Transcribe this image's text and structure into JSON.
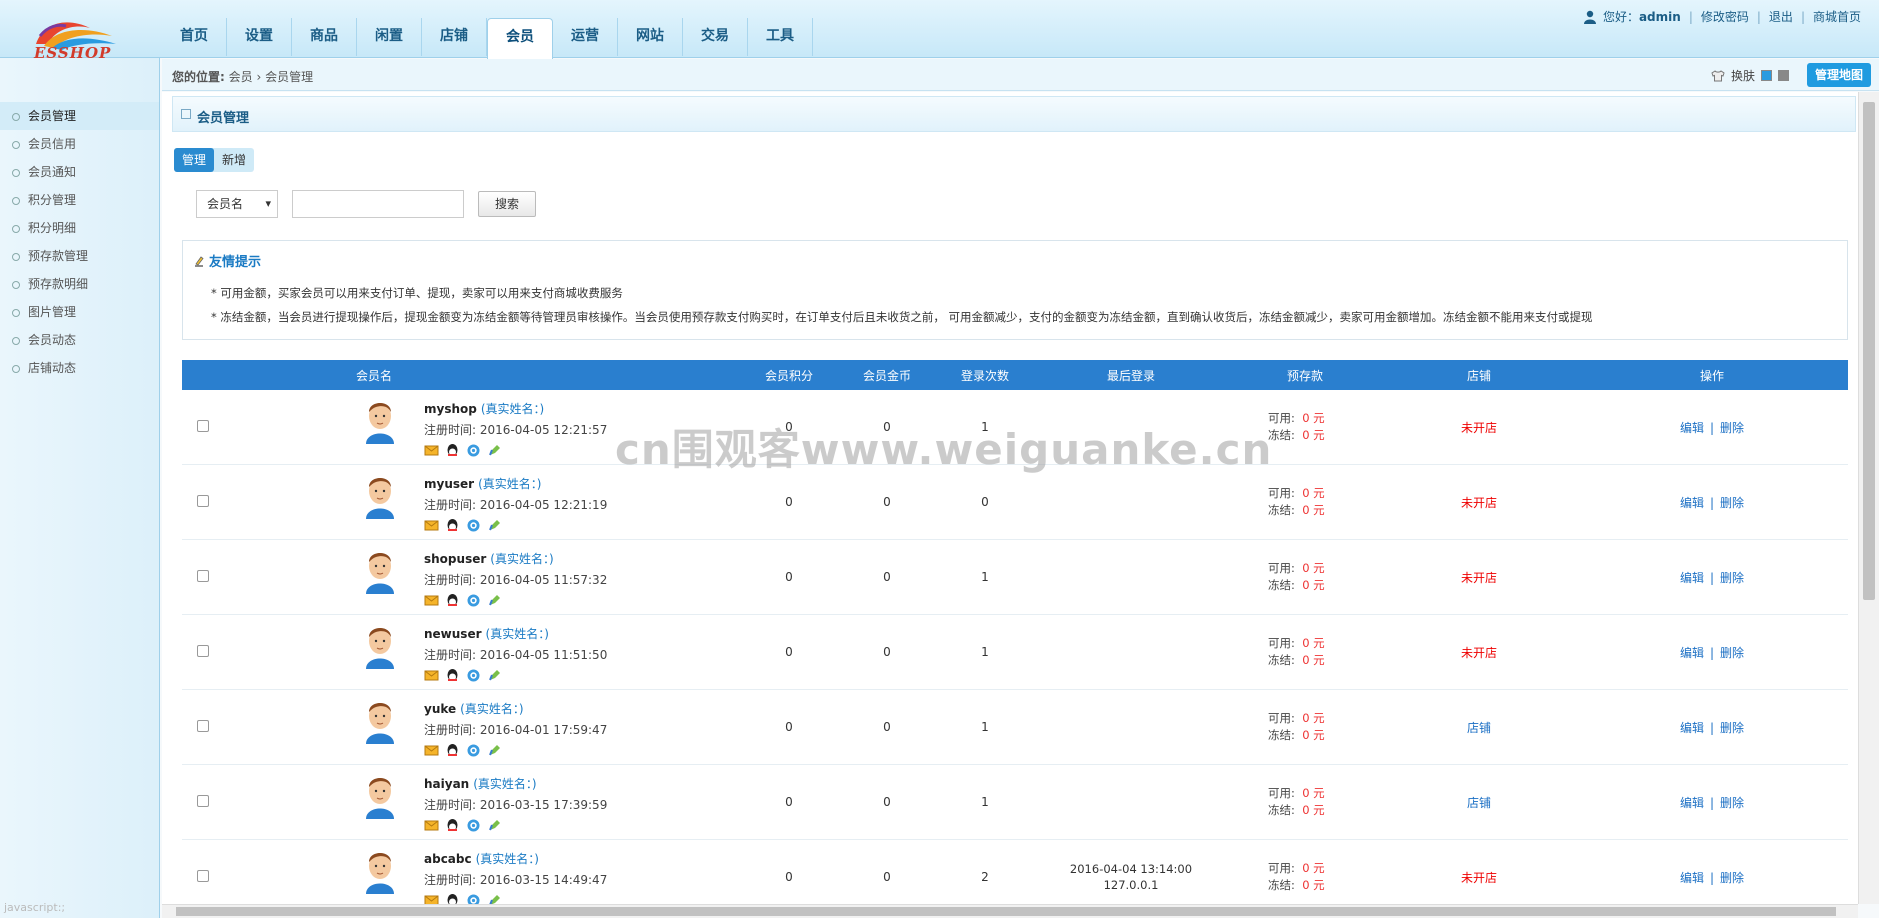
{
  "header": {
    "logo_text": "ESSHOP",
    "nav": [
      "首页",
      "设置",
      "商品",
      "闲置",
      "店铺",
      "会员",
      "运营",
      "网站",
      "交易",
      "工具"
    ],
    "active_nav": 5,
    "user_greeting": "您好：",
    "user_name": "admin",
    "change_password": "修改密码",
    "logout": "退出",
    "mall_home": "商城首页"
  },
  "sidebar": {
    "items": [
      "会员管理",
      "会员信用",
      "会员通知",
      "积分管理",
      "积分明细",
      "预存款管理",
      "预存款明细",
      "图片管理",
      "会员动态",
      "店铺动态"
    ],
    "active": 0,
    "status_text": "javascript:;"
  },
  "breadcrumb": {
    "label": "您的位置:",
    "path1": "会员",
    "arrow": "›",
    "path2": "会员管理"
  },
  "skin": {
    "label": "换肤",
    "colors": [
      "#2a9be0",
      "#888888"
    ]
  },
  "map_button": "管理地图",
  "panel": {
    "title": "会员管理"
  },
  "tabs": [
    "管理",
    "新增"
  ],
  "search": {
    "select_value": "会员名",
    "button": "搜索",
    "placeholder": ""
  },
  "tips": {
    "title": "友情提示",
    "items": [
      "*  可用金额，买家会员可以用来支付订单、提现，卖家可以用来支付商城收费服务",
      "*  冻结金额，当会员进行提现操作后，提现金额变为冻结金额等待管理员审核操作。当会员使用预存款支付购买时，在订单支付后且未收货之前， 可用金额减少，支付的金额变为冻结金额，直到确认收货后，冻结金额减少，卖家可用金额增加。冻结金额不能用来支付或提现"
    ]
  },
  "table": {
    "headers": [
      "会员名",
      "会员积分",
      "会员金币",
      "登录次数",
      "最后登录",
      "预存款",
      "店铺",
      "操作"
    ],
    "realname_label": "(真实姓名：)",
    "regtime_label": "注册时间:",
    "available_label": "可用:",
    "frozen_label": "冻结:",
    "edit": "编辑",
    "delete": "删除",
    "op_sep": "|",
    "rows": [
      {
        "name": "myshop",
        "reg": "2016-04-05 12:21:57",
        "points": "0",
        "gold": "0",
        "logins": "1",
        "last_time": "",
        "last_ip": "",
        "avail": "0 元",
        "frozen": "0 元",
        "shop": "未开店",
        "shop_open": false
      },
      {
        "name": "myuser",
        "reg": "2016-04-05 12:21:19",
        "points": "0",
        "gold": "0",
        "logins": "0",
        "last_time": "",
        "last_ip": "",
        "avail": "0 元",
        "frozen": "0 元",
        "shop": "未开店",
        "shop_open": false
      },
      {
        "name": "shopuser",
        "reg": "2016-04-05 11:57:32",
        "points": "0",
        "gold": "0",
        "logins": "1",
        "last_time": "",
        "last_ip": "",
        "avail": "0 元",
        "frozen": "0 元",
        "shop": "未开店",
        "shop_open": false
      },
      {
        "name": "newuser",
        "reg": "2016-04-05 11:51:50",
        "points": "0",
        "gold": "0",
        "logins": "1",
        "last_time": "",
        "last_ip": "",
        "avail": "0 元",
        "frozen": "0 元",
        "shop": "未开店",
        "shop_open": false
      },
      {
        "name": "yuke",
        "reg": "2016-04-01 17:59:47",
        "points": "0",
        "gold": "0",
        "logins": "1",
        "last_time": "",
        "last_ip": "",
        "avail": "0 元",
        "frozen": "0 元",
        "shop": "店铺",
        "shop_open": true
      },
      {
        "name": "haiyan",
        "reg": "2016-03-15 17:39:59",
        "points": "0",
        "gold": "0",
        "logins": "1",
        "last_time": "",
        "last_ip": "",
        "avail": "0 元",
        "frozen": "0 元",
        "shop": "店铺",
        "shop_open": true
      },
      {
        "name": "abcabc",
        "reg": "2016-03-15 14:49:47",
        "points": "0",
        "gold": "0",
        "logins": "2",
        "last_time": "2016-04-04 13:14:00",
        "last_ip": "127.0.0.1",
        "avail": "0 元",
        "frozen": "0 元",
        "shop": "未开店",
        "shop_open": false
      }
    ]
  },
  "watermark": "cn围观客www.weiguanke.cn"
}
